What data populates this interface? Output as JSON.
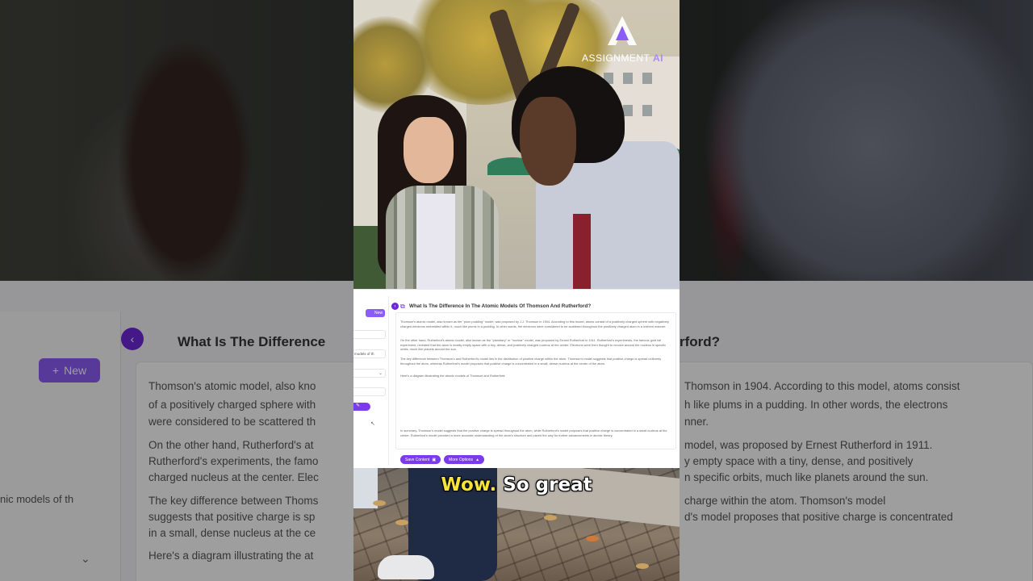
{
  "brand": {
    "name": "ASSIGNMENT",
    "suffix": "AI",
    "accent": "#7c3aed"
  },
  "sidebar": {
    "new_label": "New",
    "history_item": "models of th",
    "icon": "pencil-icon"
  },
  "main": {
    "title": "What Is The Difference In The Atomic Models Of Thomson And Rutherford?",
    "paragraphs": [
      "Thomson's atomic model, also known as the \"plum pudding\" model, was proposed by J.J. Thomson in 1904. According to this model, atoms consist of a positively charged sphere with negatively charged electrons embedded within it, much like plums in a pudding. In other words, the electrons were considered to be scattered throughout the positively charged atom in a uniform manner.",
      "On the other hand, Rutherford's atomic model, also known as the \"planetary\" or \"nuclear\" model, was proposed by Ernest Rutherford in 1911. Rutherford's experiments, the famous gold foil experiment, revealed that the atom is mostly empty space with a tiny, dense, and positively charged nucleus at the center. Electrons were then thought to revolve around the nucleus in specific orbits, much like planets around the sun.",
      "The key difference between Thomson's and Rutherford's model lies in the distribution of positive charge within the atom. Thomson's model suggests that positive charge is spread uniformly throughout the atom, whereas Rutherford's model proposes that positive charge is concentrated in a small, dense nucleus at the center of the atom.",
      "Here's a diagram illustrating the atomic models of Thomson and Rutherford:",
      "In summary, Thomson's model suggests that the positive charge is spread throughout the atom, while Rutherford's model proposes that positive charge is concentrated in a small nucleus at the center. Rutherford's model provided a more accurate understanding of the atom's structure and paved the way for further advancements in atomic theory."
    ],
    "actions": {
      "save_label": "Save Content",
      "more_label": "More Options"
    }
  },
  "caption": {
    "highlight": "Wow.",
    "rest": " So great"
  },
  "background": {
    "left_title": "What Is The Difference",
    "right_title": "rford?",
    "new_label": "New",
    "history_item": "nic models of th",
    "lines_left": [
      "Thomson's atomic model, also kno",
      "of a positively charged sphere with",
      "were considered to be scattered th",
      "On the other hand, Rutherford's at",
      "Rutherford's experiments, the famo",
      "charged nucleus at the center. Elec",
      "The key difference between Thoms",
      "suggests that positive charge is sp",
      "in a small, dense nucleus at the ce",
      "Here's a diagram illustrating the at"
    ],
    "lines_right": [
      "Thomson in 1904. According to this model, atoms consist",
      "h like plums in a pudding. In other words, the electrons",
      "nner.",
      "model, was proposed by Ernest Rutherford in 1911.",
      "y empty space with a tiny, dense, and positively",
      "n specific orbits, much like planets around the sun.",
      "charge within the atom. Thomson's model",
      "d's model proposes that positive charge is concentrated"
    ]
  }
}
